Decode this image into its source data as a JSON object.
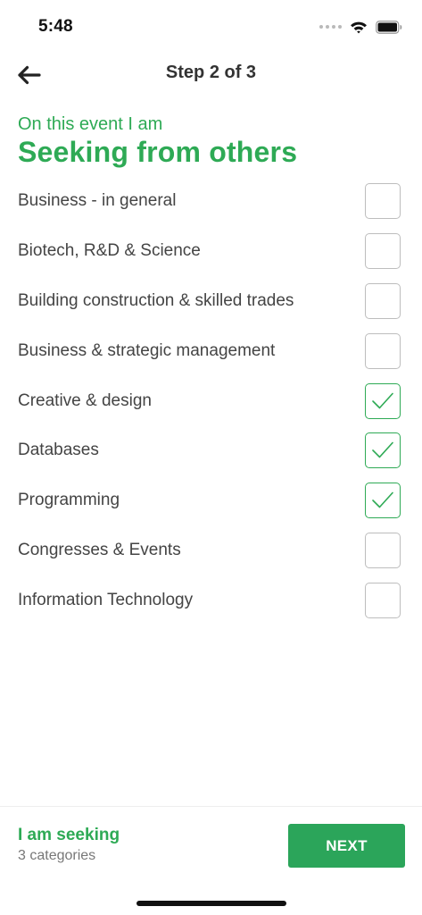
{
  "status_bar": {
    "time": "5:48",
    "icons": [
      "signal-icon",
      "wifi-icon",
      "battery-icon"
    ]
  },
  "nav": {
    "back_icon": "arrow-left-icon",
    "title": "Step 2 of 3"
  },
  "header": {
    "subtitle": "On this event I am",
    "title": "Seeking from others"
  },
  "categories": [
    {
      "label": "Business - in general",
      "checked": false
    },
    {
      "label": "Biotech, R&D & Science",
      "checked": false
    },
    {
      "label": "Building construction & skilled trades",
      "checked": false
    },
    {
      "label": "Business & strategic management",
      "checked": false
    },
    {
      "label": "Creative & design",
      "checked": true
    },
    {
      "label": "Databases",
      "checked": true
    },
    {
      "label": "Programming",
      "checked": true
    },
    {
      "label": "Congresses & Events",
      "checked": false
    },
    {
      "label": "Information Technology",
      "checked": false
    }
  ],
  "footer": {
    "title": "I am seeking",
    "count": "3 categories",
    "next_label": "NEXT"
  },
  "colors": {
    "accent": "#2eaa55",
    "button": "#2ba55a",
    "text": "#444444"
  }
}
